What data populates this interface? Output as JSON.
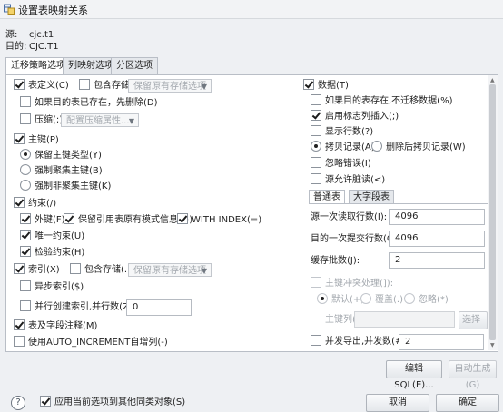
{
  "window": {
    "title": "设置表映射关系"
  },
  "info": {
    "source_label": "源:",
    "source_value": "cjc.t1",
    "target_label": "目的:",
    "target_value": "CJC.T1"
  },
  "tabs": [
    "迁移策略选项",
    "列映射选项",
    "分区选项"
  ],
  "left": {
    "table_def": "表定义(C)",
    "include_storage": "包含存储(I)",
    "storage_combo": "保留原有存储选项",
    "delete_if_exists": "如果目的表已存在，先删除(D)",
    "compress": "压缩(;)",
    "compress_combo": "配置压缩属性...",
    "primary_key": "主键(P)",
    "keep_pk_type": "保留主键类型(Y)",
    "force_clustered": "强制聚集主键(B)",
    "force_nonclustered": "强制非聚集主键(K)",
    "constraint": "约束(/)",
    "foreign_key": "外键(F)",
    "keep_ref_schema": "保留引用表原有模式信息(>)",
    "with_index": "WITH INDEX(=)",
    "unique": "唯一约束(U)",
    "check": "检验约束(H)",
    "index": "索引(X)",
    "include_storage2": "包含存储(.)",
    "storage_combo2": "保留原有存储选项",
    "async_index": "异步索引($)",
    "parallel_index": "并行创建索引,并行数(Z):",
    "parallel_value": "0",
    "table_comment": "表及字段注释(M)",
    "auto_increment": "使用AUTO_INCREMENT自增列(-)"
  },
  "right": {
    "data": "数据(T)",
    "no_migrate": "如果目的表存在,不迁移数据(%)",
    "enable_identity": "启用标志列插入(;)",
    "show_rows": "显示行数(?)",
    "copy_record": "拷贝记录(A)",
    "delete_copy": "删除后拷贝记录(W)",
    "ignore_error": "忽略错误(I)",
    "allow_dirty": "源允许脏读(<)",
    "subtabs": [
      "普通表",
      "大字段表"
    ],
    "read_rows_label": "源一次读取行数(I):",
    "read_rows_value": "4096",
    "commit_rows_label": "目的一次提交行数(Q):",
    "commit_rows_value": "4096",
    "batch_label": "缓存批数(J):",
    "batch_value": "2",
    "pk_conflict": "主键冲突处理(]):",
    "default_opt": "默认(+)",
    "overwrite_opt": "覆盖(.)",
    "ignore_opt": "忽略(*)",
    "pk_col_label": "主键列(')",
    "select_col_btn": "选择列(",
    "concurrent_label": "并发导出,并发数(#):",
    "concurrent_value": "2"
  },
  "buttons": {
    "edit_sql": "编辑SQL(E)...",
    "auto_generate": "自动生成(G)",
    "apply_all": "应用当前选项到其他同类对象(S)",
    "cancel": "取消",
    "ok": "确定"
  }
}
